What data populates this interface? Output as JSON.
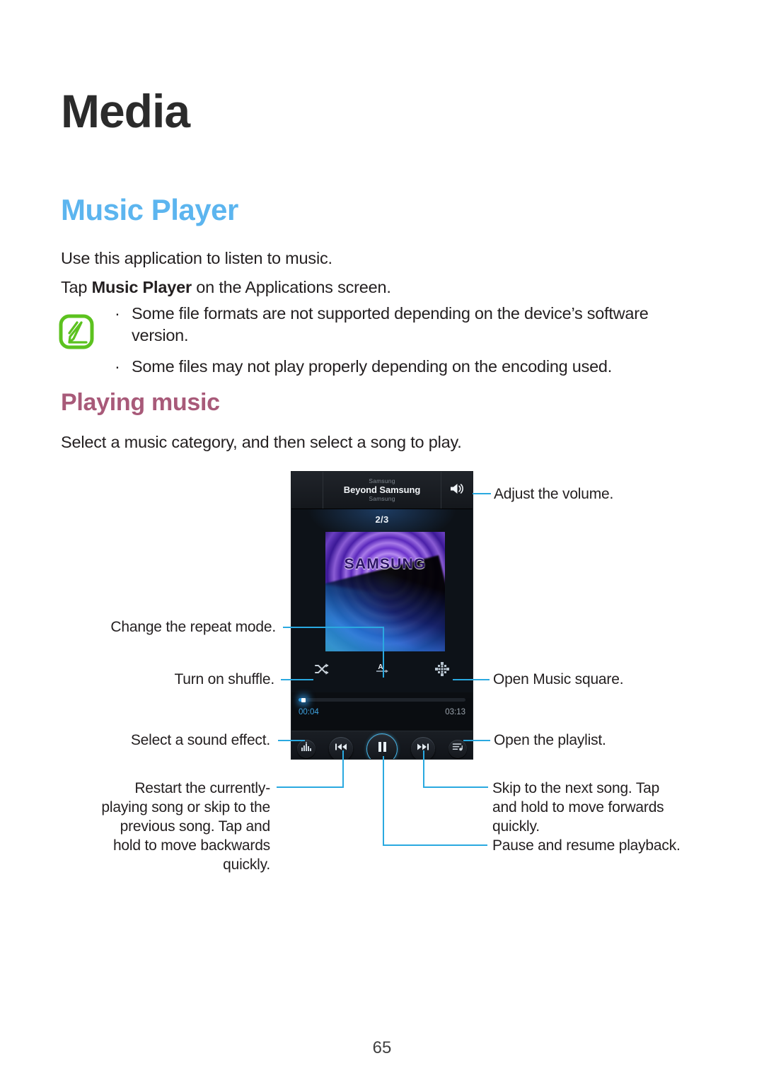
{
  "document": {
    "chapter_title": "Media",
    "page_number": "65"
  },
  "section": {
    "heading": "Music Player",
    "intro_1": "Use this application to listen to music.",
    "intro_2_prefix": "Tap ",
    "intro_2_bold": "Music Player",
    "intro_2_suffix": " on the Applications screen.",
    "note_icon": "note-icon",
    "bullet_char": "·",
    "notes": [
      "Some file formats are not supported depending on the device’s software version.",
      "Some files may not play properly depending on the encoding used."
    ]
  },
  "subsection": {
    "heading": "Playing music",
    "intro": "Select a music category, and then select a song to play."
  },
  "phone": {
    "header": {
      "artist_top": "Samsung",
      "track_title": "Beyond Samsung",
      "album_bottom": "Samsung",
      "volume_icon": "volume-icon"
    },
    "track_count": "2/3",
    "album_art_text": "SAMSUNG",
    "options": {
      "shuffle_icon": "shuffle-icon",
      "repeat_icon": "repeat-all-icon",
      "repeat_label": "A",
      "music_square_icon": "music-square-icon"
    },
    "progress": {
      "current_time": "00:04",
      "total_time": "03:13",
      "percent": 3
    },
    "controls": {
      "sound_effect_icon": "sound-effect-icon",
      "previous_icon": "previous-track-icon",
      "pause_icon": "pause-icon",
      "next_icon": "next-track-icon",
      "playlist_icon": "playlist-icon"
    }
  },
  "callouts": {
    "volume": "Adjust the volume.",
    "repeat": "Change the repeat mode.",
    "shuffle": "Turn on shuffle.",
    "music_square": "Open Music square.",
    "sound_effect": "Select a sound effect.",
    "playlist": "Open the playlist.",
    "previous": "Restart the currently-playing song or skip to the previous song. Tap and hold to move backwards quickly.",
    "next": "Skip to the next song. Tap and hold to move forwards quickly.",
    "pause": "Pause and resume playback."
  },
  "colors": {
    "heading_blue": "#5cb5ef",
    "subheading_rose": "#a85a79",
    "callout_line": "#2aa9e0",
    "note_icon_green": "#5cc21f",
    "accent_progress": "#2f9fe0"
  }
}
